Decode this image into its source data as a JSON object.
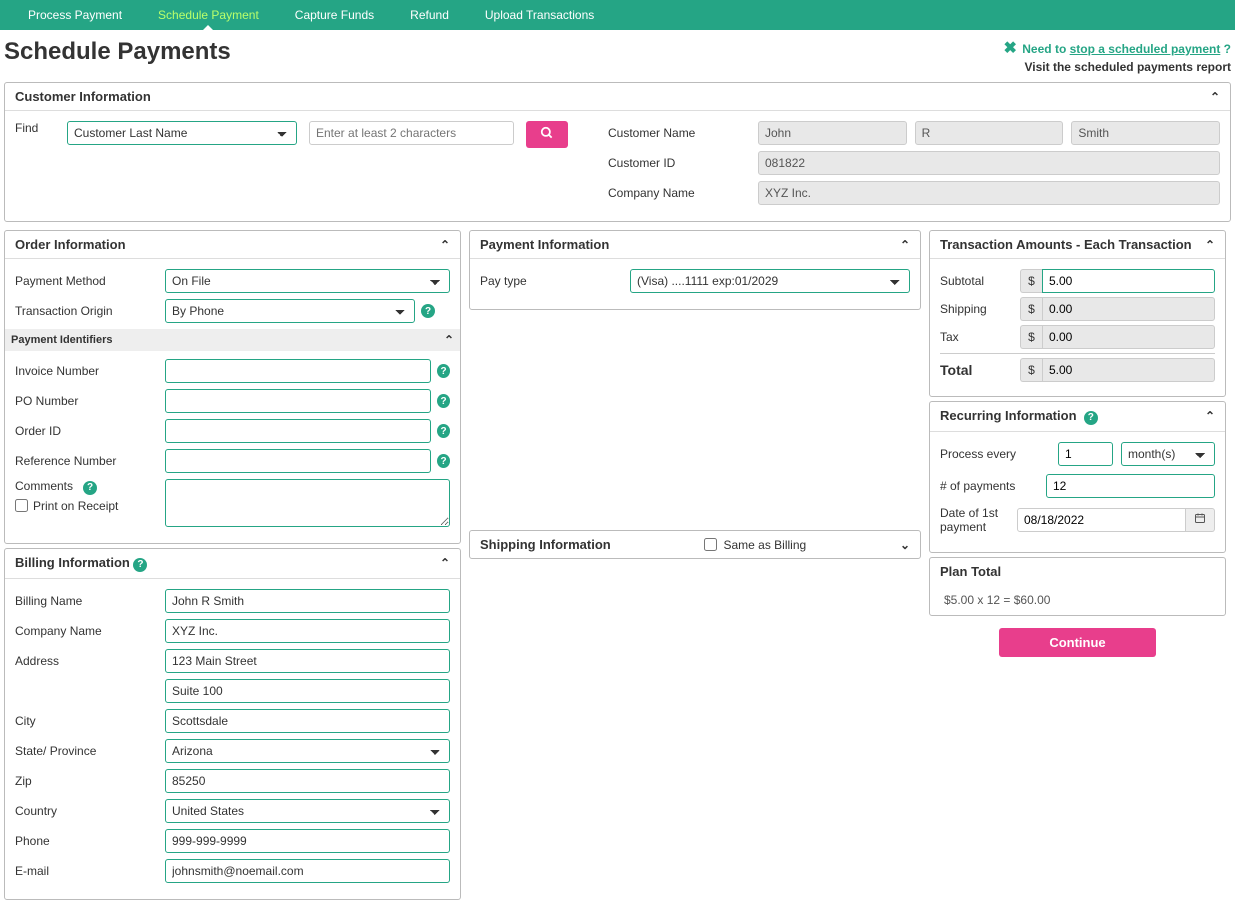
{
  "nav": {
    "process_payment": "Process Payment",
    "schedule_payment": "Schedule Payment",
    "capture_funds": "Capture Funds",
    "refund": "Refund",
    "upload_transactions": "Upload Transactions"
  },
  "header": {
    "title": "Schedule Payments",
    "need_to": "Need to",
    "stop_link": "stop a scheduled payment",
    "visit": "Visit the scheduled payments report"
  },
  "customer_info": {
    "title": "Customer Information",
    "find_label": "Find",
    "find_by": "Customer Last Name",
    "find_placeholder": "Enter at least 2 characters",
    "name_label": "Customer Name",
    "first": "John",
    "middle": "R",
    "last": "Smith",
    "id_label": "Customer ID",
    "id": "081822",
    "company_label": "Company Name",
    "company": "XYZ Inc."
  },
  "order_info": {
    "title": "Order Information",
    "payment_method_label": "Payment Method",
    "payment_method": "On File",
    "transaction_origin_label": "Transaction Origin",
    "transaction_origin": "By Phone",
    "identifiers_title": "Payment Identifiers",
    "invoice_label": "Invoice Number",
    "po_label": "PO Number",
    "order_id_label": "Order ID",
    "reference_label": "Reference Number",
    "comments_label": "Comments",
    "print_receipt_label": "Print on Receipt"
  },
  "billing_info": {
    "title": "Billing Information",
    "name_label": "Billing Name",
    "name": "John R Smith",
    "company_label": "Company Name",
    "company": "XYZ Inc.",
    "address_label": "Address",
    "address1": "123 Main Street",
    "address2": "Suite 100",
    "city_label": "City",
    "city": "Scottsdale",
    "state_label": "State/ Province",
    "state": "Arizona",
    "zip_label": "Zip",
    "zip": "85250",
    "country_label": "Country",
    "country": "United States",
    "phone_label": "Phone",
    "phone": "999-999-9999",
    "email_label": "E-mail",
    "email": "johnsmith@noemail.com"
  },
  "payment_info": {
    "title": "Payment Information",
    "pay_type_label": "Pay type",
    "pay_type": "(Visa) ....1111 exp:01/2029"
  },
  "shipping_info": {
    "title": "Shipping Information",
    "same_as_billing_label": "Same as Billing"
  },
  "amounts": {
    "title": "Transaction Amounts - Each Transaction",
    "currency": "$",
    "subtotal_label": "Subtotal",
    "subtotal": "5.00",
    "shipping_label": "Shipping",
    "shipping": "0.00",
    "tax_label": "Tax",
    "tax": "0.00",
    "total_label": "Total",
    "total": "5.00"
  },
  "recurring": {
    "title": "Recurring Information",
    "process_every_label": "Process every",
    "process_every": "1",
    "unit": "month(s)",
    "num_payments_label": "# of payments",
    "num_payments": "12",
    "first_date_label": "Date of 1st payment",
    "first_date": "08/18/2022"
  },
  "plan_total": {
    "title": "Plan Total",
    "text": "$5.00 x 12 = $60.00"
  },
  "actions": {
    "continue": "Continue"
  }
}
